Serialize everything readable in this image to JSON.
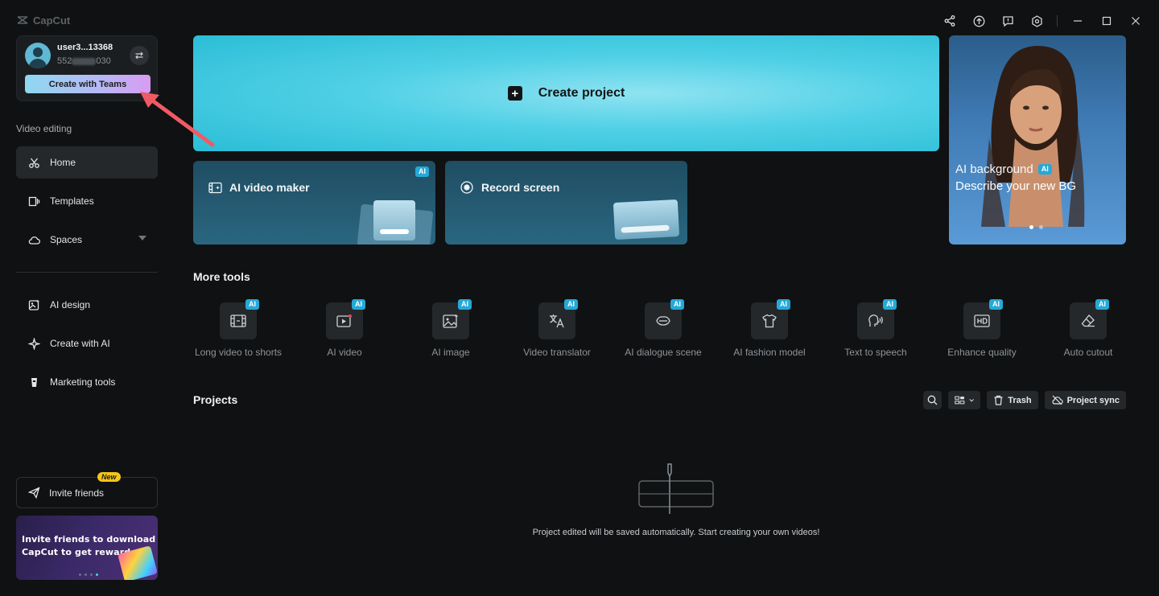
{
  "app": {
    "logo_text": "CapCut"
  },
  "user": {
    "name": "user3...13368",
    "id_prefix": "552",
    "id_suffix": "030",
    "teams_label": "Create with Teams"
  },
  "sidebar": {
    "section_label": "Video editing",
    "items": [
      {
        "label": "Home",
        "icon": "home-scissors-icon"
      },
      {
        "label": "Templates",
        "icon": "templates-icon"
      },
      {
        "label": "Spaces",
        "icon": "cloud-icon"
      },
      {
        "label": "AI design",
        "icon": "ai-design-icon"
      },
      {
        "label": "Create with AI",
        "icon": "sparkle-icon"
      },
      {
        "label": "Marketing tools",
        "icon": "marketing-icon"
      }
    ],
    "invite": {
      "label": "Invite friends",
      "badge": "New"
    },
    "promo": {
      "line1": "Invite friends to download",
      "line2": "CapCut to get rewards"
    }
  },
  "main": {
    "create_project": "Create project",
    "cards": [
      {
        "title": "AI video maker",
        "badge": "AI"
      },
      {
        "title": "Record screen"
      }
    ],
    "ai_background": {
      "title": "AI background",
      "badge": "AI",
      "subtitle": "Describe your new BG"
    },
    "more_tools_title": "More tools",
    "tools": [
      {
        "label": "Long video to shorts",
        "badge": "AI",
        "icon": "long-video-icon"
      },
      {
        "label": "AI video",
        "badge": "AI",
        "icon": "ai-video-icon"
      },
      {
        "label": "AI image",
        "badge": "AI",
        "icon": "ai-image-icon"
      },
      {
        "label": "Video translator",
        "badge": "AI",
        "icon": "translate-icon"
      },
      {
        "label": "AI dialogue scene",
        "badge": "AI",
        "icon": "dialogue-icon"
      },
      {
        "label": "AI fashion model",
        "badge": "AI",
        "icon": "shirt-icon"
      },
      {
        "label": "Text to speech",
        "badge": "AI",
        "icon": "speech-icon"
      },
      {
        "label": "Enhance quality",
        "badge": "AI",
        "icon": "hd-icon"
      },
      {
        "label": "Auto cutout",
        "badge": "AI",
        "icon": "eraser-icon"
      }
    ],
    "projects_title": "Projects",
    "trash_label": "Trash",
    "sync_label": "Project sync",
    "empty_message": "Project edited will be saved automatically. Start creating your own videos!"
  },
  "colors": {
    "accent": "#25a9d8",
    "create_card": "#4fd0e6",
    "background": "#0f1112",
    "annotation_arrow": "#f05a64"
  }
}
